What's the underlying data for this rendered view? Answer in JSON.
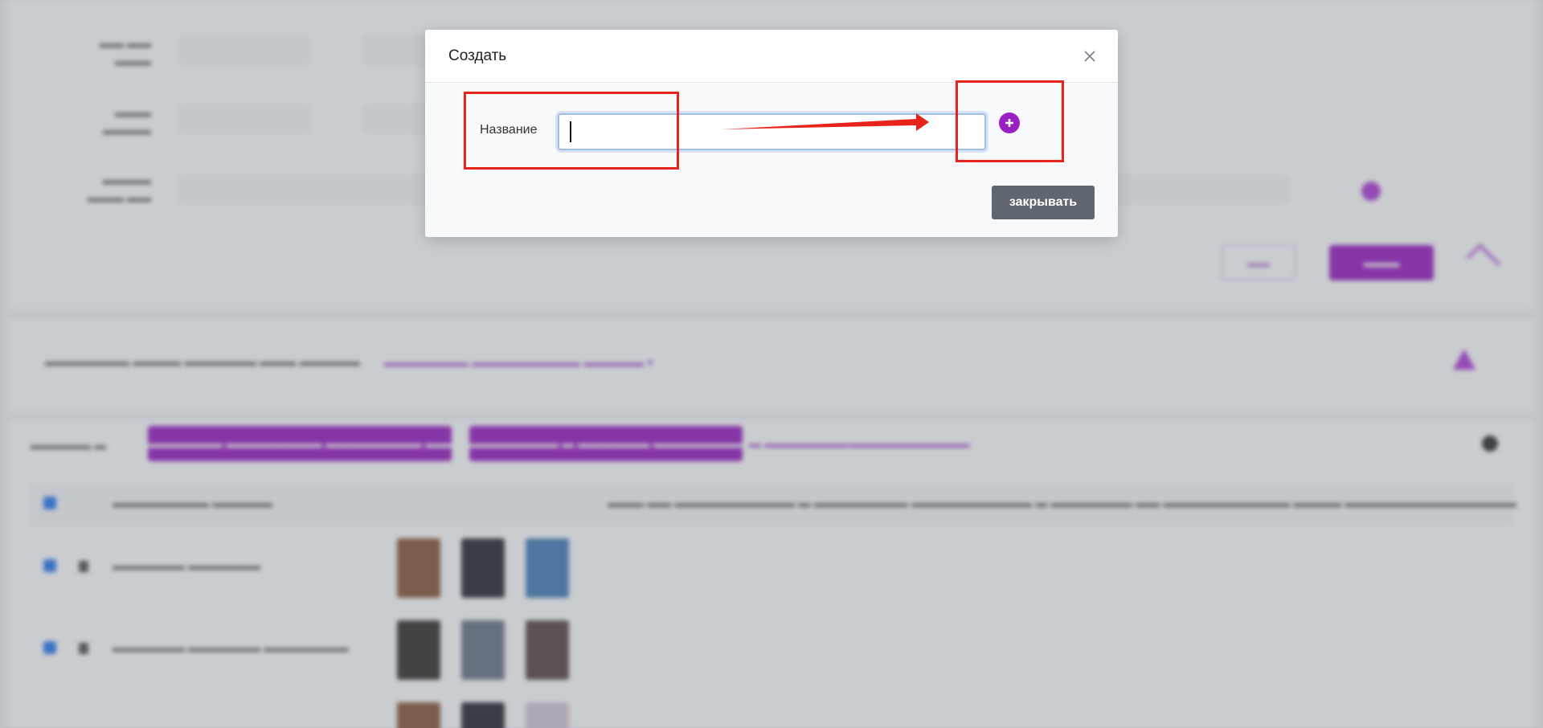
{
  "modal": {
    "title": "Создать",
    "field_label": "Название",
    "input_value": "",
    "input_placeholder": "",
    "add_icon": "plus-circle-icon",
    "close_icon": "close-icon",
    "close_button_label": "закрывать"
  },
  "colors": {
    "accent": "#9a1fc2",
    "close_button": "#5f6670",
    "annotation": "#e8231b",
    "overlay": "rgba(90,98,110,0.32)"
  }
}
